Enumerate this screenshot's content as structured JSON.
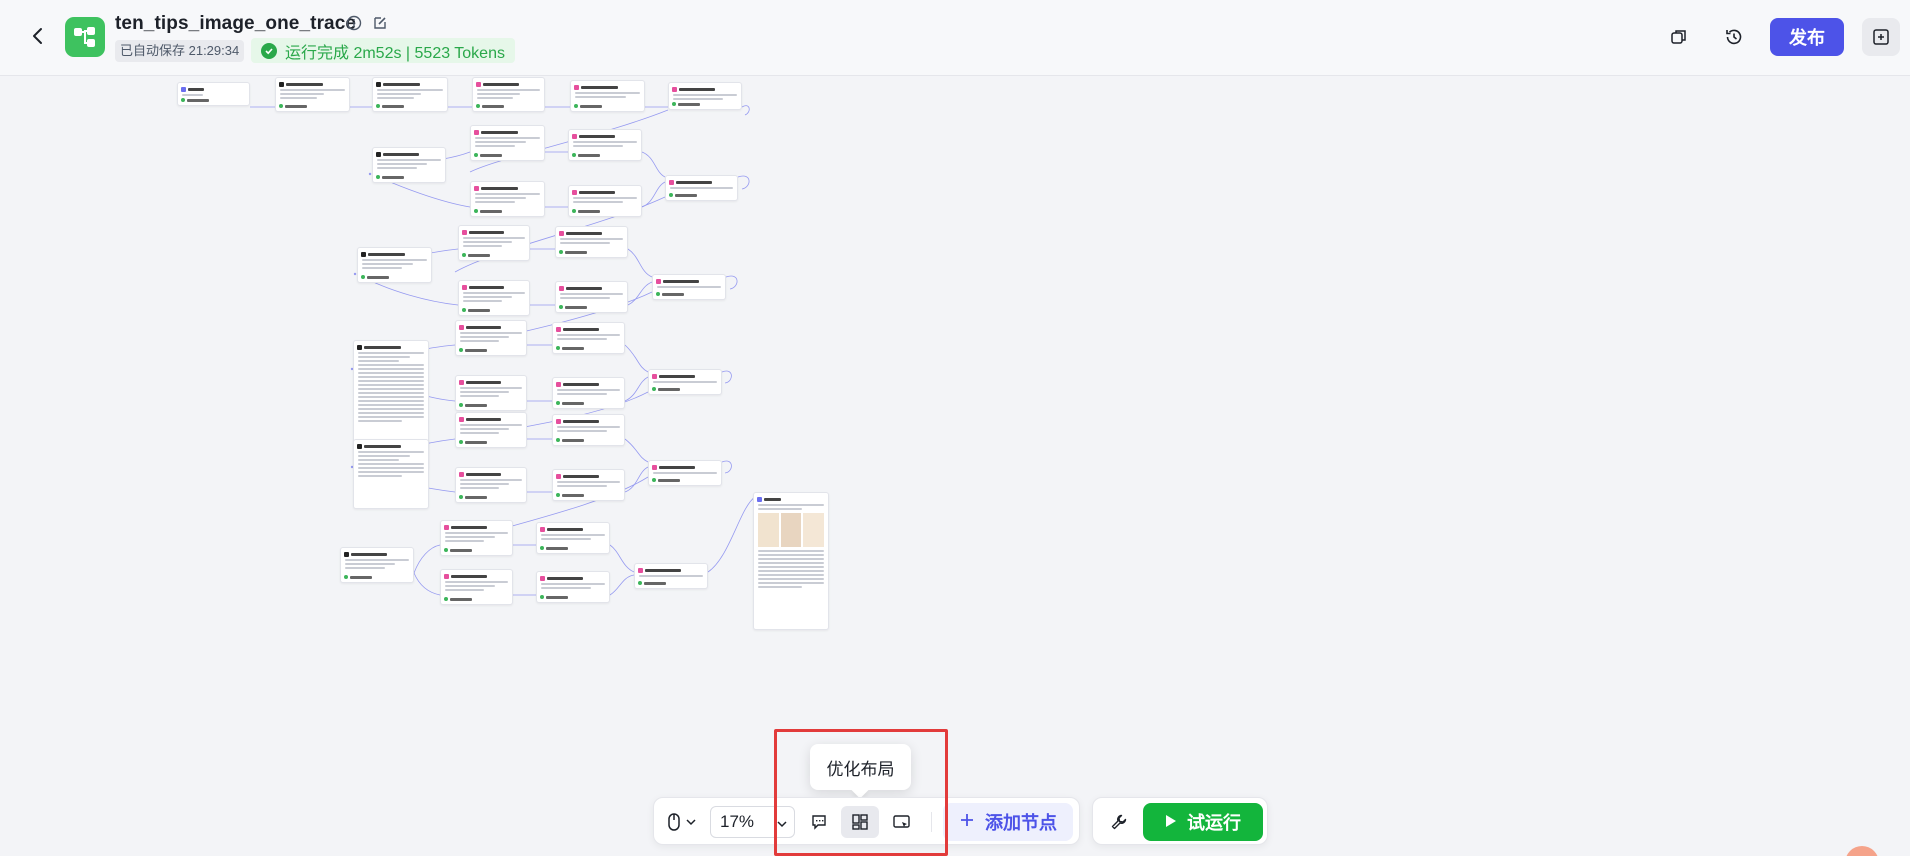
{
  "header": {
    "title": "ten_tips_image_one_trace",
    "autosave": "已自动保存 21:29:34",
    "run_status": "运行完成 2m52s | 5523 Tokens",
    "publish_label": "发布"
  },
  "toolbar": {
    "zoom": "17%",
    "add_node_label": "添加节点",
    "test_run_label": "试运行",
    "tooltip": "优化布局"
  },
  "colors": {
    "accent": "#4d53e8",
    "success": "#13b53c",
    "highlight": "#e23b3b"
  },
  "icons": [
    "back-icon",
    "app-logo-icon",
    "info-icon",
    "edit-icon",
    "copy-icon",
    "history-icon",
    "side-panel-icon",
    "mouse-icon",
    "comment-icon",
    "layout-icon",
    "minimap-icon",
    "plus-icon",
    "wrench-icon",
    "play-icon"
  ]
}
